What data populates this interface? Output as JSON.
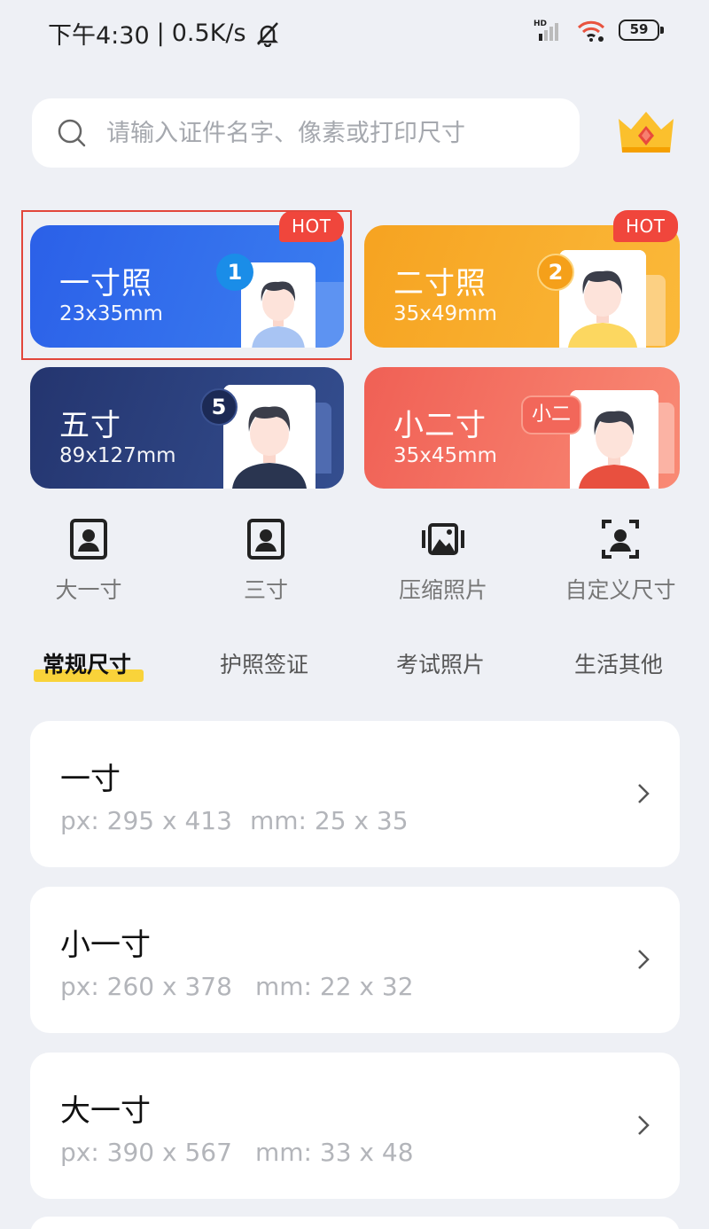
{
  "status": {
    "time": "下午4:30",
    "speed": "0.5K/s",
    "signal_label": "HD",
    "battery": "59"
  },
  "search": {
    "placeholder": "请输入证件名字、像素或打印尺寸"
  },
  "feature_cards": [
    {
      "title": "一寸照",
      "size": "23x35mm",
      "badge": "1",
      "hot": "HOT",
      "color": "#2f6bed"
    },
    {
      "title": "二寸照",
      "size": "35x49mm",
      "badge": "2",
      "hot": "HOT",
      "color": "#f7a826"
    },
    {
      "title": "五寸",
      "size": "89x127mm",
      "badge": "5",
      "color": "#283b78"
    },
    {
      "title": "小二寸",
      "size": "35x45mm",
      "badge": "小二",
      "color": "#f36a5c"
    }
  ],
  "quick_actions": [
    {
      "label": "大一寸",
      "icon": "id-photo-icon"
    },
    {
      "label": "三寸",
      "icon": "id-photo-icon"
    },
    {
      "label": "压缩照片",
      "icon": "image-compress-icon"
    },
    {
      "label": "自定义尺寸",
      "icon": "custom-size-icon"
    }
  ],
  "tabs": [
    {
      "label": "常规尺寸",
      "active": true
    },
    {
      "label": "护照签证",
      "active": false
    },
    {
      "label": "考试照片",
      "active": false
    },
    {
      "label": "生活其他",
      "active": false
    }
  ],
  "list": [
    {
      "name": "一寸",
      "px": "px: 295 x 413",
      "mm": "mm: 25 x 35"
    },
    {
      "name": "小一寸",
      "px": "px: 260 x 378",
      "mm": "mm: 22 x 32"
    },
    {
      "name": "大一寸",
      "px": "px: 390 x 567",
      "mm": "mm: 33 x 48"
    }
  ],
  "colors": {
    "background": "#eef0f5",
    "accent_underline": "#f9d33a",
    "hot": "#f0463c"
  }
}
